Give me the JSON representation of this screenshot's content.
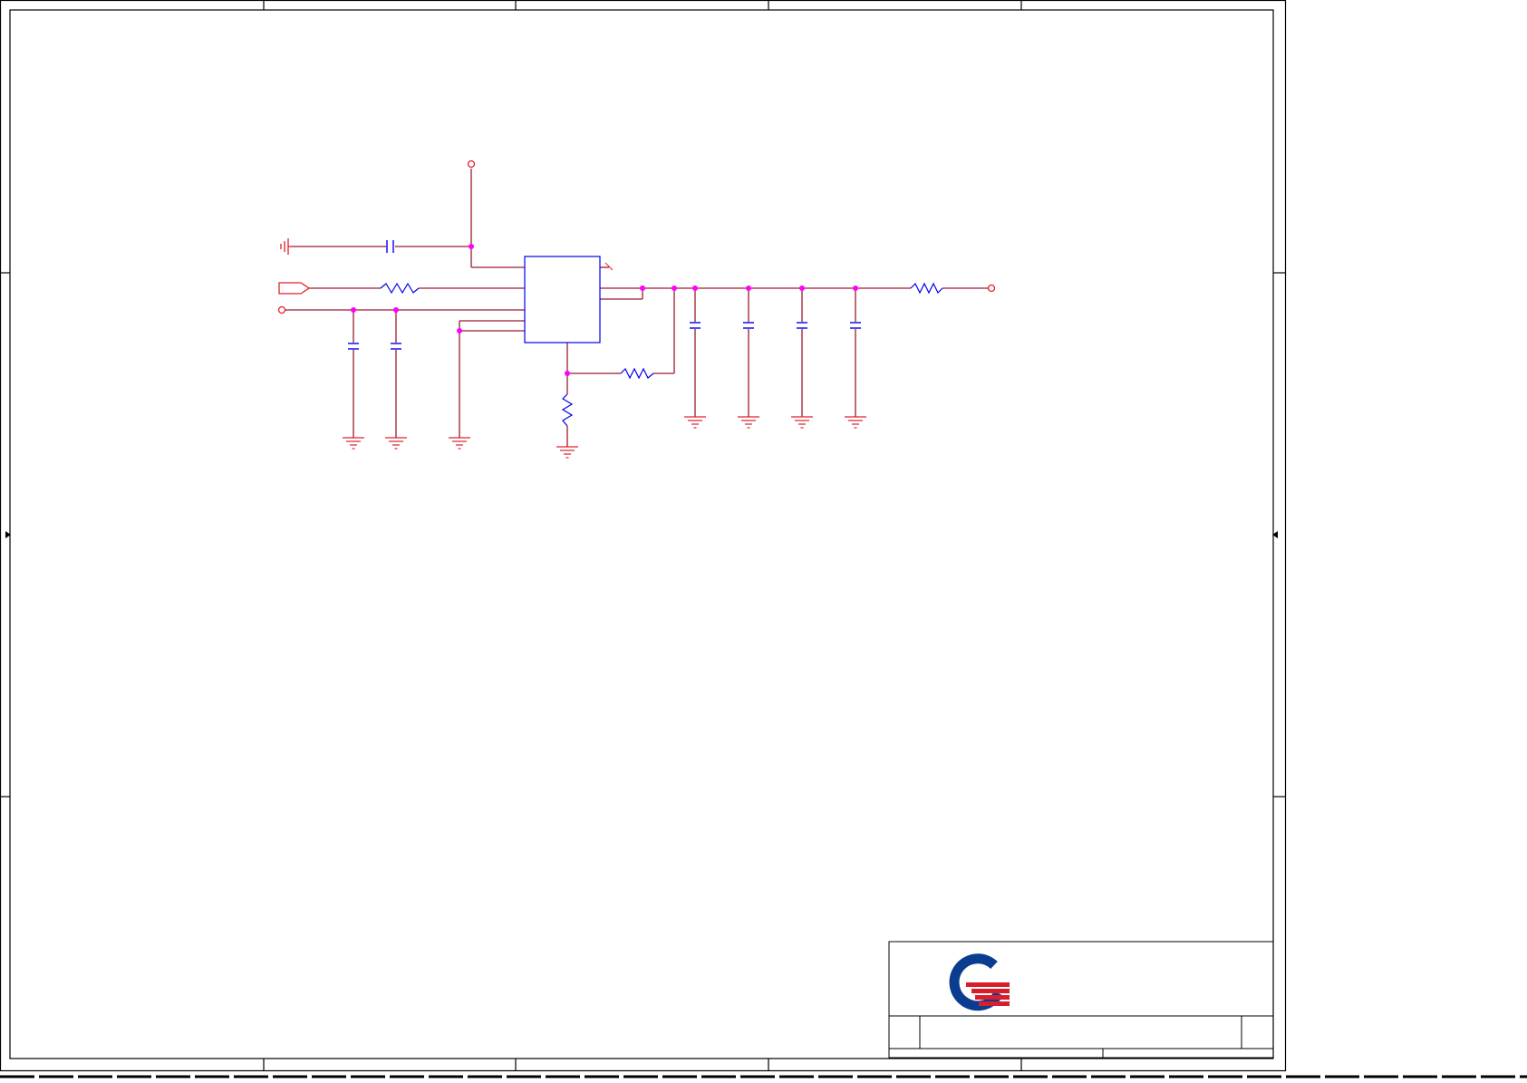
{
  "colors": {
    "frame": "#000000",
    "wire": "#9b1b30",
    "power": "#e0202a",
    "component": "#0000ee",
    "junction": "#ff00ff",
    "logo_blue": "#0a3d8f",
    "logo_red": "#d81e2c"
  },
  "logo": {
    "name": "company-logo-q"
  },
  "icons": {
    "ground": "ground-symbol-icon",
    "chassis": "chassis-ground-icon",
    "power": "power-port-icon",
    "connector": "offpage-connector-icon",
    "resistor": "resistor-icon",
    "capacitor": "capacitor-icon",
    "no_connect": "no-connect-icon"
  }
}
